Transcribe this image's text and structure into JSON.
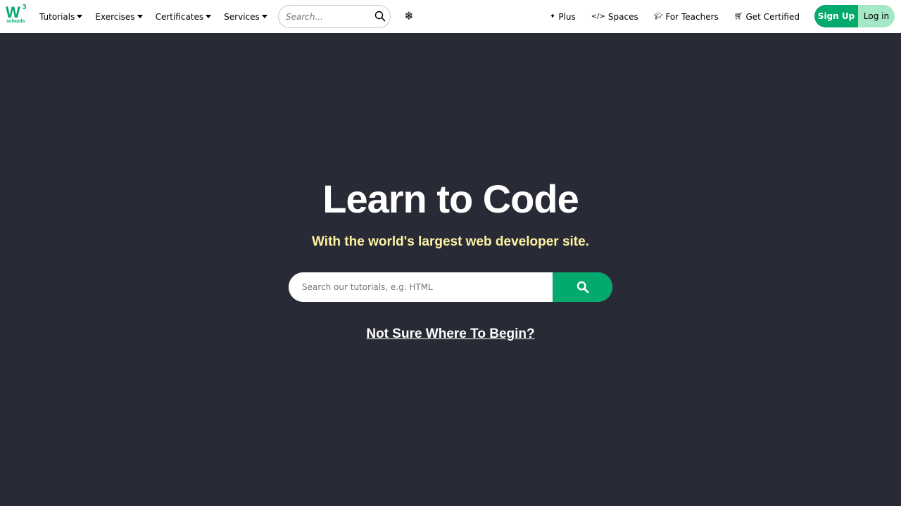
{
  "brand": {
    "logo_main": "W",
    "logo_sup": "3",
    "logo_sub": "schools",
    "accent_color": "#04AA6D"
  },
  "nav": {
    "left_items": [
      {
        "label": "Tutorials",
        "has_dropdown": true
      },
      {
        "label": "Exercises",
        "has_dropdown": true
      },
      {
        "label": "Certificates",
        "has_dropdown": true
      },
      {
        "label": "Services",
        "has_dropdown": true
      }
    ],
    "search_placeholder": "Search...",
    "theme_icon": "snowflake-icon",
    "right_items": [
      {
        "label": "Plus",
        "icon": "sparkle-icon"
      },
      {
        "label": "Spaces",
        "icon": "code-icon"
      },
      {
        "label": "For Teachers",
        "icon": "graduation-cap-icon"
      },
      {
        "label": "Get Certified",
        "icon": "cart-icon"
      }
    ],
    "signup_label": "Sign Up",
    "login_label": "Log in"
  },
  "hero": {
    "title": "Learn to Code",
    "subtitle": "With the world's largest web developer site.",
    "search_placeholder": "Search our tutorials, e.g. HTML",
    "begin_link": "Not Sure Where To Begin?",
    "background_color": "#282A35",
    "subtitle_color": "#FFF4A3"
  }
}
